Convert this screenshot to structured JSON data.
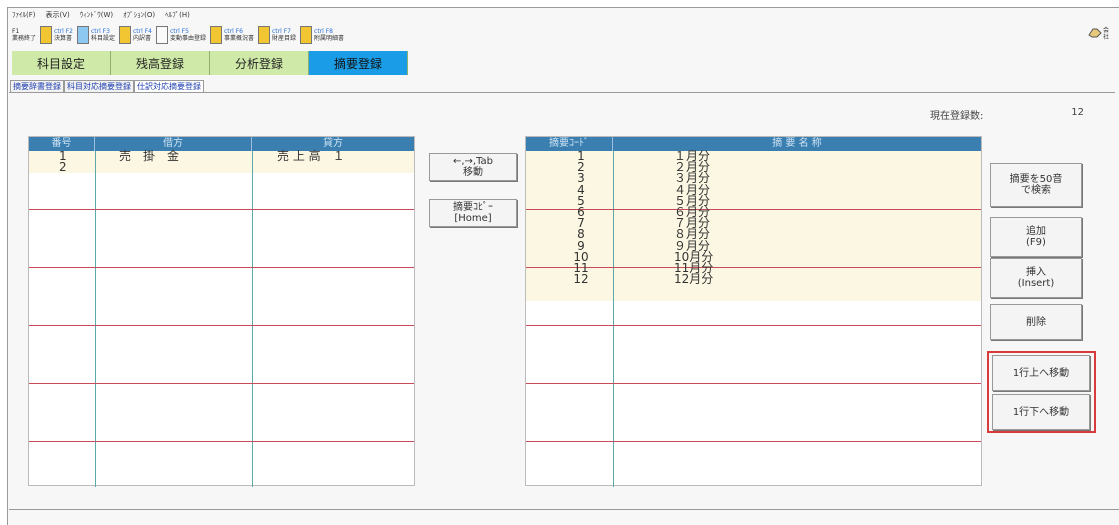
{
  "menubar": [
    "ﾌｧｲﾙ(F)",
    "表示(V)",
    "ｳｨﾝﾄﾞｳ(W)",
    "ｵﾌﾟｼｮﾝ(O)",
    "ﾍﾙﾌﾟ(H)"
  ],
  "toolbar": [
    {
      "key": "F1",
      "label": "業務終了"
    },
    {
      "key": "ctrl F2",
      "label": "決算書"
    },
    {
      "key": "ctrl F3",
      "label": "科目設定"
    },
    {
      "key": "ctrl F4",
      "label": "内訳書"
    },
    {
      "key": "ctrl F5",
      "label": "変動事由登録"
    },
    {
      "key": "ctrl F6",
      "label": "事業概況書"
    },
    {
      "key": "ctrl F7",
      "label": "財産目録"
    },
    {
      "key": "ctrl F8",
      "label": "附属明細書"
    }
  ],
  "corner_label": "会社",
  "main_tabs": [
    "科目設定",
    "残高登録",
    "分析登録",
    "摘要登録"
  ],
  "sub_tabs": [
    "摘要辞書登録",
    "科目対応摘要登録",
    "仕訳対応摘要登録"
  ],
  "count": {
    "label": "現在登録数:",
    "value": "12"
  },
  "grid1": {
    "headers": [
      "番号",
      "借方",
      "貸方"
    ],
    "rows": [
      {
        "no": "1",
        "debit": "売　掛　金",
        "credit": "売 上 高　１"
      },
      {
        "no": "2",
        "debit": "",
        "credit": ""
      }
    ]
  },
  "middle_buttons": {
    "move_line1": "←,→,Tab",
    "move_line2": "移動",
    "copy_line1": "摘要ｺﾋﾟｰ",
    "copy_line2": "[Home]"
  },
  "grid2": {
    "headers": [
      "摘要ｺｰﾄﾞ",
      "摘 要 名 称"
    ],
    "rows": [
      {
        "code": "1",
        "name": "１月分"
      },
      {
        "code": "2",
        "name": "２月分"
      },
      {
        "code": "3",
        "name": "３月分"
      },
      {
        "code": "4",
        "name": "４月分"
      },
      {
        "code": "5",
        "name": "５月分"
      },
      {
        "code": "6",
        "name": "６月分"
      },
      {
        "code": "7",
        "name": "７月分"
      },
      {
        "code": "8",
        "name": "８月分"
      },
      {
        "code": "9",
        "name": "９月分"
      },
      {
        "code": "10",
        "name": "10月分"
      },
      {
        "code": "11",
        "name": "11月分"
      },
      {
        "code": "12",
        "name": "12月分"
      }
    ]
  },
  "side_buttons": {
    "search_line1": "摘要を50音",
    "search_line2": "で検索",
    "add_line1": "追加",
    "add_line2": "(F9)",
    "insert_line1": "挿入",
    "insert_line2": "(Insert)",
    "delete": "削除",
    "move_up": "1行上へ移動",
    "move_down": "1行下へ移動"
  }
}
